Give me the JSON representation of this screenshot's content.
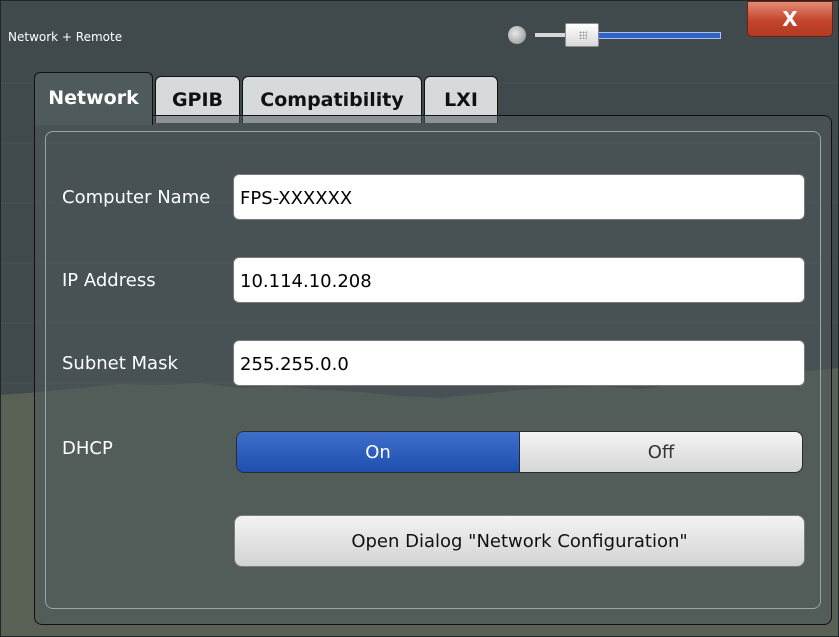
{
  "window": {
    "title": "Network + Remote",
    "close_label": "X"
  },
  "transparency": {
    "level_percent": 15
  },
  "tabs": [
    {
      "label": "Network",
      "active": true
    },
    {
      "label": "GPIB",
      "active": false
    },
    {
      "label": "Compatibility",
      "active": false
    },
    {
      "label": "LXI",
      "active": false
    }
  ],
  "network": {
    "computer_name_label": "Computer Name",
    "computer_name_value": "FPS-XXXXXX",
    "ip_address_label": "IP Address",
    "ip_address_value": "10.114.10.208",
    "subnet_mask_label": "Subnet Mask",
    "subnet_mask_value": "255.255.0.0",
    "dhcp_label": "DHCP",
    "dhcp_on_label": "On",
    "dhcp_off_label": "Off",
    "dhcp_selected": "On",
    "open_dialog_label": "Open Dialog \"Network Configuration\""
  },
  "colors": {
    "toggle_on": "#2a5bbd",
    "close_button": "#c6472e",
    "slider_track": "#2f63c4",
    "trace_fill": "#c9ca7a"
  }
}
